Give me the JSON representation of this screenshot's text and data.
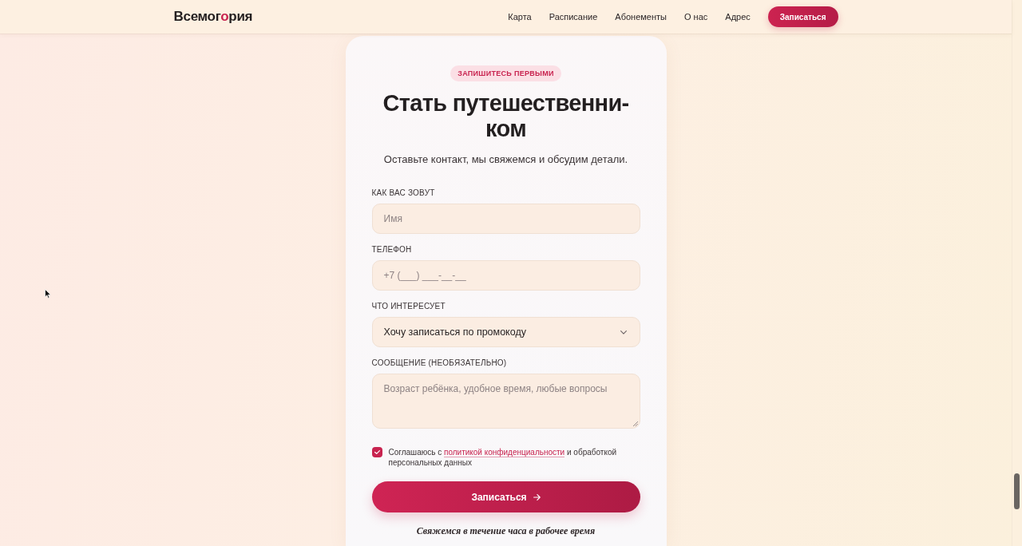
{
  "header": {
    "logo": [
      {
        "text": "Всемог",
        "accent": false
      },
      {
        "text": "о",
        "accent": true
      },
      {
        "text": "рия",
        "accent": false
      }
    ],
    "nav": [
      "Карта",
      "Расписание",
      "Абонементы",
      "О нас",
      "Адрес"
    ],
    "cta": "Записаться"
  },
  "form": {
    "badge": "ЗАПИШИТЕСЬ ПЕРВЫМИ",
    "title": "Стать путешественни-\nком",
    "subtitle": "Оставьте контакт, мы свяжемся и обсудим детали.",
    "fields": [
      {
        "kind": "input",
        "label": "КАК ВАС ЗОВУТ",
        "placeholder": "Имя"
      },
      {
        "kind": "input",
        "label": "ТЕЛЕФОН",
        "placeholder": "+7 (___) ___-__-__"
      },
      {
        "kind": "select",
        "label": "ЧТО ИНТЕРЕСУЕТ",
        "value": "Хочу записаться по промокоду"
      },
      {
        "kind": "textarea",
        "label": "СООБЩЕНИЕ (НЕОБЯЗАТЕЛЬНО)",
        "placeholder": "Возраст ребёнка, удобное время, любые вопросы"
      }
    ],
    "consent": {
      "checked": true,
      "text_before": "Соглашаюсь с",
      "link": "политикой конфиденциальности",
      "text_after": "и обработкой персональных данных"
    },
    "submit": "Записаться",
    "note": "Свяжемся в течение часа в рабочее время"
  }
}
